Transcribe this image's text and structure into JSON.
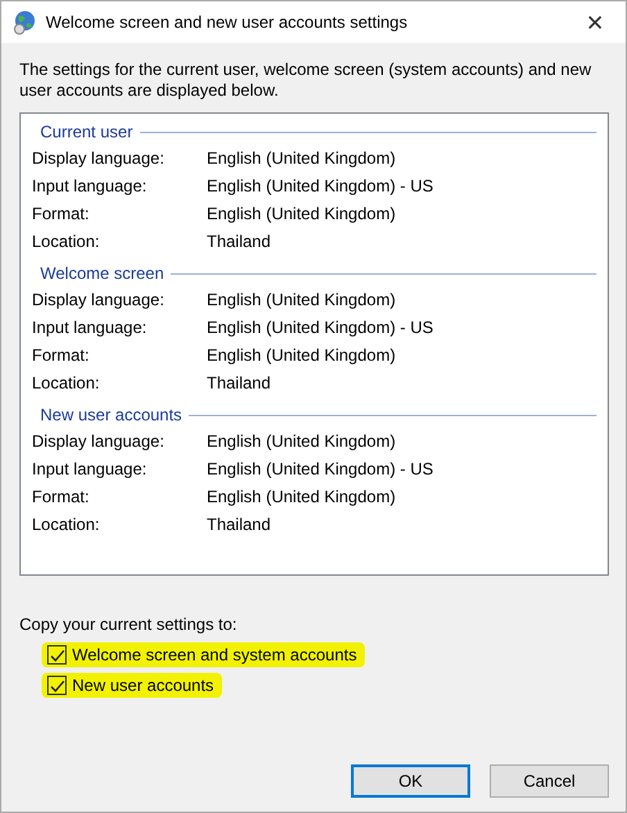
{
  "window": {
    "title": "Welcome screen and new user accounts settings",
    "close": "✕"
  },
  "intro": "The settings for the current user, welcome screen (system accounts) and new user accounts are displayed below.",
  "groups": [
    {
      "title": "Current user",
      "rows": [
        {
          "label": "Display language:",
          "value": "English (United Kingdom)"
        },
        {
          "label": "Input language:",
          "value": "English (United Kingdom) - US"
        },
        {
          "label": "Format:",
          "value": "English (United Kingdom)"
        },
        {
          "label": "Location:",
          "value": "Thailand"
        }
      ]
    },
    {
      "title": "Welcome screen",
      "rows": [
        {
          "label": "Display language:",
          "value": "English (United Kingdom)"
        },
        {
          "label": "Input language:",
          "value": "English (United Kingdom) - US"
        },
        {
          "label": "Format:",
          "value": "English (United Kingdom)"
        },
        {
          "label": "Location:",
          "value": "Thailand"
        }
      ]
    },
    {
      "title": "New user accounts",
      "rows": [
        {
          "label": "Display language:",
          "value": "English (United Kingdom)"
        },
        {
          "label": "Input language:",
          "value": "English (United Kingdom) - US"
        },
        {
          "label": "Format:",
          "value": "English (United Kingdom)"
        },
        {
          "label": "Location:",
          "value": "Thailand"
        }
      ]
    }
  ],
  "copy_label": "Copy your current settings to:",
  "checkboxes": [
    {
      "label": "Welcome screen and system accounts",
      "checked": true,
      "highlighted": true
    },
    {
      "label": "New user accounts",
      "checked": true,
      "highlighted": true
    }
  ],
  "buttons": [
    {
      "label": "OK",
      "selected": true
    },
    {
      "label": "Cancel",
      "selected": false
    }
  ]
}
